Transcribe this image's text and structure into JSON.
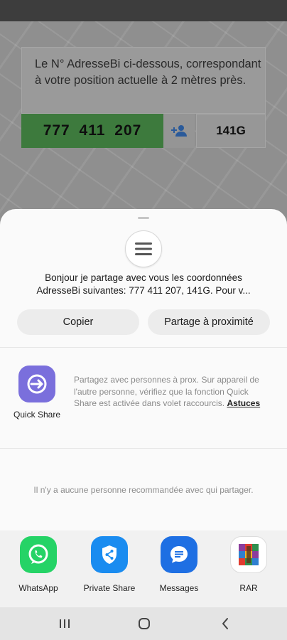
{
  "background_app": {
    "info_text": "Le N° AdresseBi ci-dessous, correspondant à votre position actuelle à 2 mètres près.",
    "code_number": "777 411 207",
    "code_suffix": "141G",
    "code_color": "#3d7a3d"
  },
  "share_sheet": {
    "app_icon": "menu-lines-icon",
    "text_line1": "Bonjour je partage avec vous les coordonnées",
    "text_line2": "AdresseBi suivantes: 777 411 207,  141G. Pour v...",
    "copy_label": "Copier",
    "nearby_label": "Partage à proximité",
    "quick_share": {
      "label": "Quick Share",
      "description": "Partagez avec personnes à prox. Sur appareil de l'autre personne, vérifiez que la fonction Quick Share est activée dans volet raccourcis.",
      "link_label": "Astuces",
      "icon_color": "#7a6fdc"
    },
    "no_recommendation": "Il n'y a aucune personne recommandée avec qui partager.",
    "apps": [
      {
        "label": "WhatsApp",
        "icon": "whatsapp-icon",
        "color": "#25d366"
      },
      {
        "label": "Private Share",
        "icon": "private-share-icon",
        "color": "#1a8cf0"
      },
      {
        "label": "Messages",
        "icon": "messages-icon",
        "color": "#1e6fe3"
      },
      {
        "label": "RAR",
        "icon": "rar-icon",
        "color": "#8b3d9c"
      }
    ]
  },
  "nav": {
    "recent_icon": "recent-apps-icon",
    "home_icon": "home-icon",
    "back_icon": "back-icon"
  }
}
